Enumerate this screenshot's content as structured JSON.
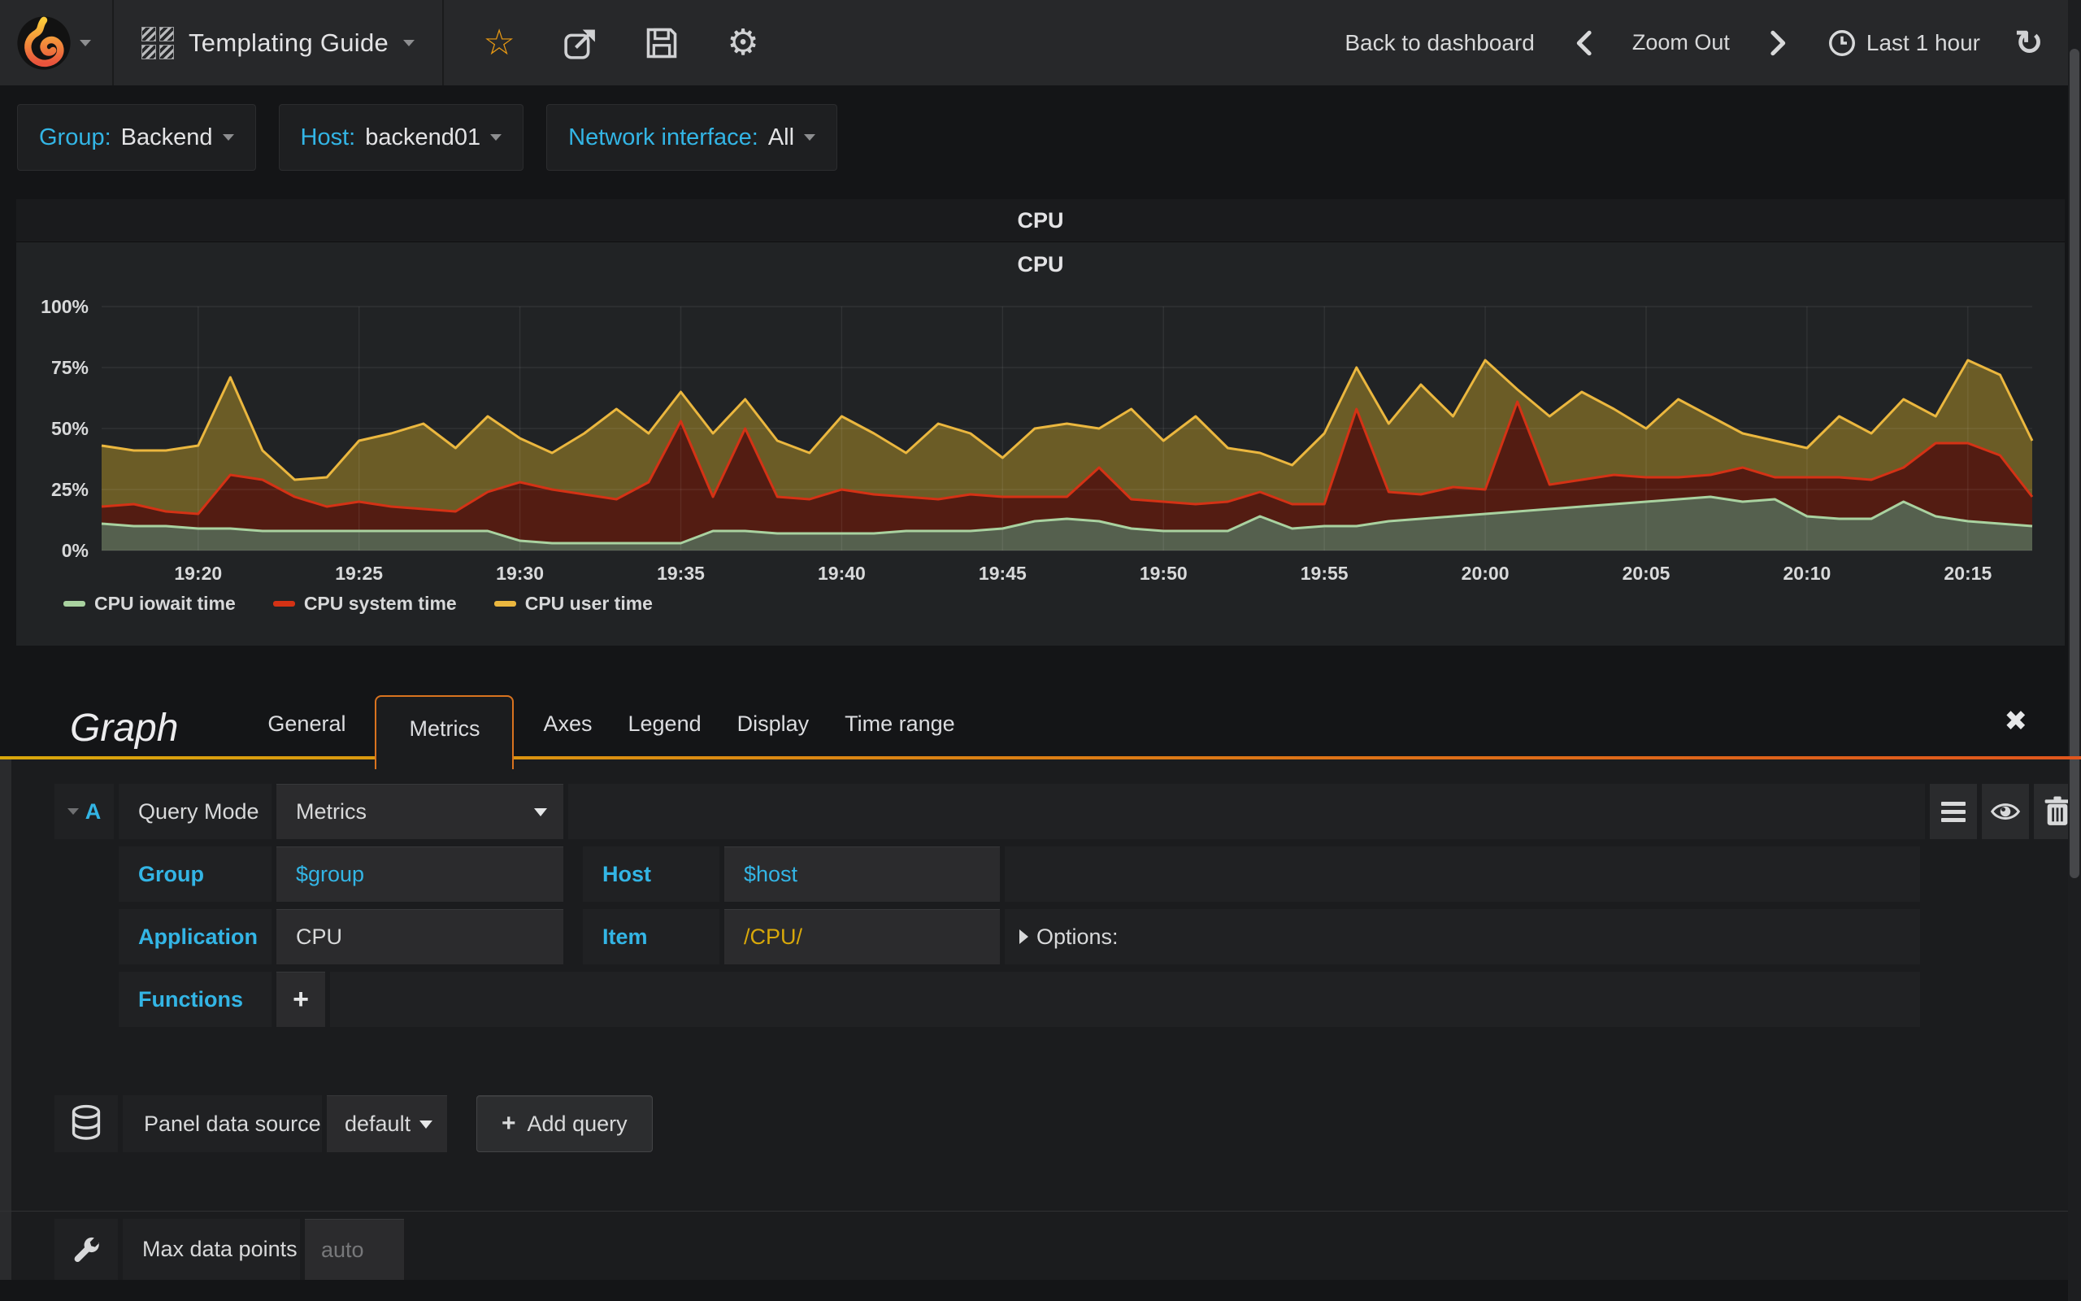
{
  "navbar": {
    "title": "Templating Guide",
    "back_to_dashboard": "Back to dashboard",
    "zoom_out": "Zoom Out",
    "time_range": "Last 1 hour"
  },
  "icons": {
    "star": "☆",
    "gear": "⚙",
    "refresh": "↻",
    "close": "✖",
    "plus": "+"
  },
  "variables": [
    {
      "label": "Group:",
      "value": "Backend"
    },
    {
      "label": "Host:",
      "value": "backend01"
    },
    {
      "label": "Network interface:",
      "value": "All"
    }
  ],
  "panel": {
    "title": "CPU",
    "chart_title": "CPU"
  },
  "chart_data": {
    "type": "area",
    "stacked": true,
    "title": "CPU",
    "xlabel": "",
    "ylabel": "",
    "unit": "%",
    "ylim": [
      0,
      100
    ],
    "yticks": [
      0,
      25,
      50,
      75,
      100
    ],
    "x_start": "19:17",
    "x_end": "20:17",
    "x_step_minutes": 1,
    "grid": true,
    "legend_position": "bottom",
    "xticks": [
      {
        "i": 3,
        "label": "19:20"
      },
      {
        "i": 8,
        "label": "19:25"
      },
      {
        "i": 13,
        "label": "19:30"
      },
      {
        "i": 18,
        "label": "19:35"
      },
      {
        "i": 23,
        "label": "19:40"
      },
      {
        "i": 28,
        "label": "19:45"
      },
      {
        "i": 33,
        "label": "19:50"
      },
      {
        "i": 38,
        "label": "19:55"
      },
      {
        "i": 43,
        "label": "20:00"
      },
      {
        "i": 48,
        "label": "20:05"
      },
      {
        "i": 53,
        "label": "20:10"
      },
      {
        "i": 58,
        "label": "20:15"
      }
    ],
    "series": [
      {
        "name": "CPU iowait time",
        "color": "#A9D2A0",
        "fill": "#55604E",
        "values": [
          11,
          10,
          10,
          9,
          9,
          8,
          8,
          8,
          8,
          8,
          8,
          8,
          8,
          4,
          3,
          3,
          3,
          3,
          3,
          8,
          8,
          7,
          7,
          7,
          7,
          8,
          8,
          8,
          9,
          12,
          13,
          12,
          9,
          8,
          8,
          8,
          14,
          9,
          10,
          10,
          12,
          13,
          14,
          15,
          16,
          17,
          18,
          19,
          20,
          21,
          22,
          20,
          21,
          14,
          13,
          13,
          20,
          14,
          12,
          11,
          10
        ]
      },
      {
        "name": "CPU system time",
        "color": "#D43215",
        "fill": "#531C12",
        "values": [
          7,
          9,
          6,
          6,
          22,
          21,
          14,
          10,
          12,
          10,
          9,
          8,
          16,
          24,
          22,
          20,
          18,
          25,
          50,
          14,
          42,
          15,
          14,
          18,
          16,
          14,
          13,
          15,
          13,
          10,
          9,
          22,
          12,
          12,
          11,
          12,
          10,
          10,
          9,
          48,
          12,
          10,
          12,
          10,
          45,
          10,
          11,
          12,
          10,
          9,
          9,
          14,
          9,
          16,
          17,
          16,
          14,
          30,
          32,
          28,
          12
        ]
      },
      {
        "name": "CPU user time",
        "color": "#EBB73F",
        "fill": "#6B5C26",
        "values": [
          25,
          22,
          25,
          28,
          40,
          12,
          7,
          12,
          25,
          30,
          35,
          26,
          31,
          18,
          15,
          25,
          37,
          20,
          12,
          26,
          12,
          23,
          19,
          30,
          25,
          18,
          31,
          25,
          16,
          28,
          30,
          16,
          37,
          25,
          36,
          22,
          16,
          16,
          29,
          17,
          28,
          45,
          29,
          53,
          5,
          28,
          36,
          27,
          20,
          32,
          24,
          14,
          15,
          12,
          25,
          19,
          28,
          11,
          34,
          33,
          23
        ]
      }
    ]
  },
  "editor": {
    "title": "Graph",
    "tabs": [
      "General",
      "Metrics",
      "Axes",
      "Legend",
      "Display",
      "Time range"
    ],
    "active_tab": "Metrics",
    "query": {
      "letter": "A",
      "query_mode_label": "Query Mode",
      "query_mode_value": "Metrics",
      "group_label": "Group",
      "group_value": "$group",
      "host_label": "Host",
      "host_value": "$host",
      "application_label": "Application",
      "application_value": "CPU",
      "item_label": "Item",
      "item_value": "/CPU/",
      "options_label": "Options:",
      "functions_label": "Functions"
    },
    "datasource": {
      "label": "Panel data source",
      "value": "default",
      "add_query_label": "Add query"
    },
    "footer": {
      "label": "Max data points",
      "placeholder": "auto"
    }
  }
}
